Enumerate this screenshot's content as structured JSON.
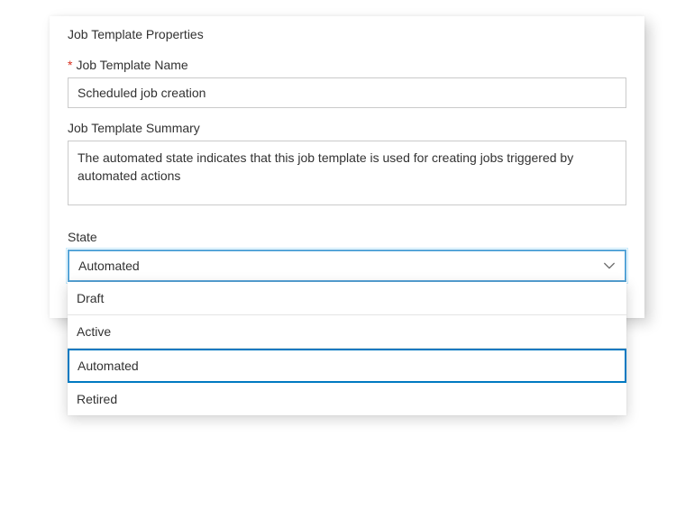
{
  "panel": {
    "title": "Job Template Properties"
  },
  "fields": {
    "name": {
      "label": "Job Template Name",
      "required_mark": "*",
      "value": "Scheduled job creation"
    },
    "summary": {
      "label": "Job Template Summary",
      "value": "The automated state indicates that this job template is used for creating jobs triggered by automated actions"
    },
    "state": {
      "label": "State",
      "selected": "Automated",
      "options": [
        "Draft",
        "Active",
        "Automated",
        "Retired"
      ]
    }
  }
}
